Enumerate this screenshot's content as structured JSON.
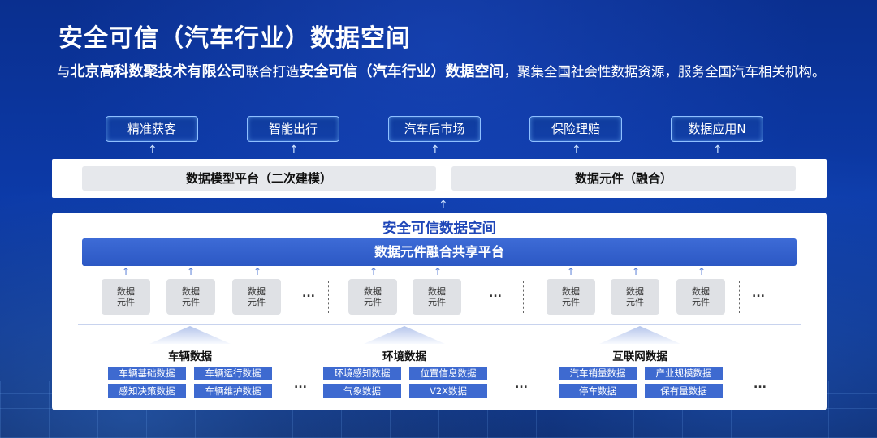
{
  "title": "安全可信（汽车行业）数据空间",
  "intro": {
    "p1": "与",
    "company": "北京高科数聚技术有限公司",
    "p2": "联合打造",
    "space": "安全可信（汽车行业）数据空间",
    "p3": "，聚集全国社会性数据资源，服务全国汽车相关机构。"
  },
  "applications": [
    "精准获客",
    "智能出行",
    "汽车后市场",
    "保险理赔",
    "数据应用N"
  ],
  "model_layer": {
    "left": "数据模型平台（二次建模）",
    "right": "数据元件（融合）"
  },
  "space_title": "安全可信数据空间",
  "platform": "数据元件融合共享平台",
  "element_label_line1": "数据",
  "element_label_line2": "元件",
  "ellipsis": "...",
  "categories": [
    {
      "title": "车辆数据",
      "items": [
        "车辆基础数据",
        "车辆运行数据",
        "感知决策数据",
        "车辆维护数据"
      ]
    },
    {
      "title": "环境数据",
      "items": [
        "环境感知数据",
        "位置信息数据",
        "气象数据",
        "V2X数据"
      ]
    },
    {
      "title": "互联网数据",
      "items": [
        "汽车销量数据",
        "产业规模数据",
        "停车数据",
        "保有量数据"
      ]
    }
  ],
  "colors": {
    "background": "#0c3aa8",
    "platform_bar": "#2c58c4",
    "source_box": "#3e6ad0",
    "space_title": "#1e46b8"
  }
}
